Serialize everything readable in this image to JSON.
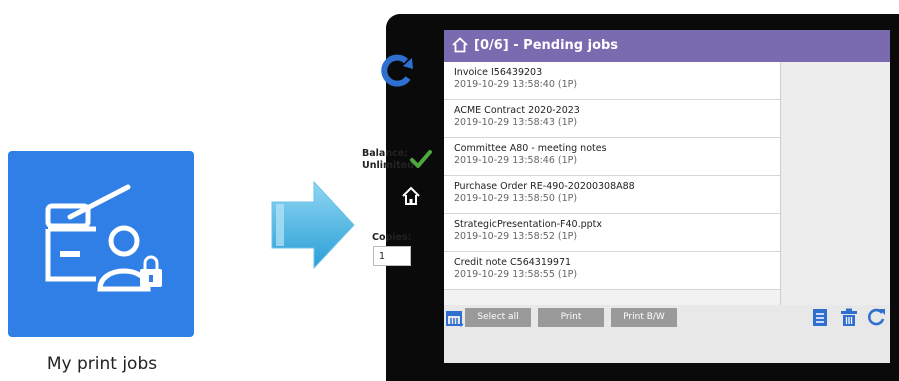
{
  "app_tile": {
    "label": "My print jobs",
    "icon": "printer-user-lock-icon",
    "color": "#2f7fe6"
  },
  "screen": {
    "title": "[0/6] - Pending jobs",
    "header_color": "#7a6bb0",
    "jobs": [
      {
        "title": "Invoice I56439203",
        "detail": "2019-10-29 13:58:40 (1P)"
      },
      {
        "title": "ACME Contract 2020-2023",
        "detail": "2019-10-29 13:58:43 (1P)"
      },
      {
        "title": "Committee A80 - meeting notes",
        "detail": "2019-10-29 13:58:46 (1P)"
      },
      {
        "title": "Purchase Order RE-490-20200308A88",
        "detail": "2019-10-29 13:58:50 (1P)"
      },
      {
        "title": "StrategicPresentation-F40.pptx",
        "detail": "2019-10-29 13:58:52 (1P)"
      },
      {
        "title": "Credit note C564319971",
        "detail": "2019-10-29 13:58:55 (1P)"
      }
    ],
    "balance_label": "Balance:",
    "balance_value": "Unlimited",
    "copies_label": "Copies:",
    "copies_value": "1",
    "buttons": {
      "select_all": "Select all",
      "print": "Print",
      "print_bw": "Print B/W"
    }
  }
}
